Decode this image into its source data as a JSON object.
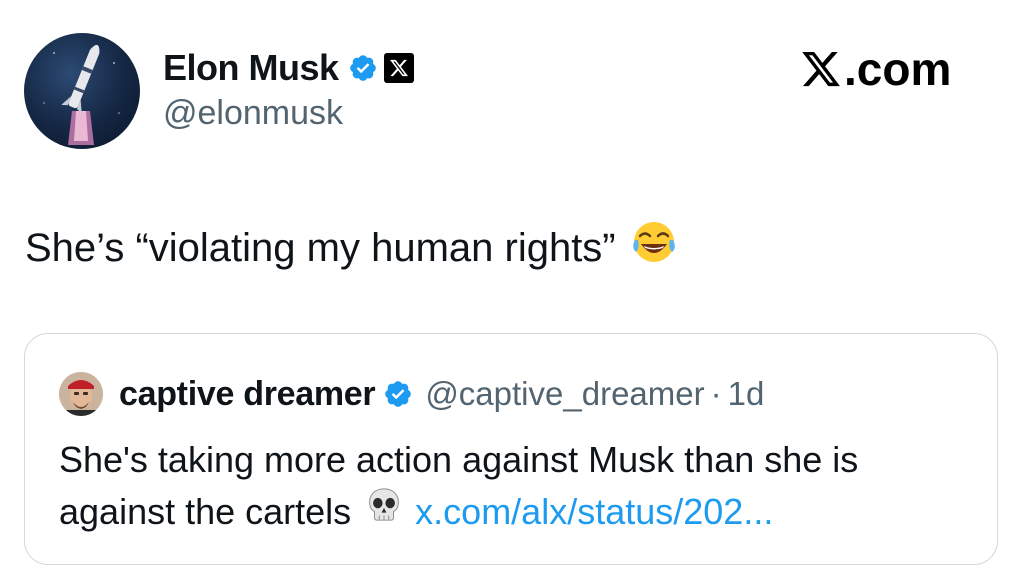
{
  "author": {
    "display_name": "Elon Musk",
    "handle": "@elonmusk",
    "verified_badge_color": "#1d9bf0",
    "avatar_icon": "rocket-launch-avatar",
    "affiliate_icon": "x-logo-icon"
  },
  "site": {
    "label": ".com",
    "logo_icon": "x-logo-icon"
  },
  "tweet": {
    "text": "She’s “violating my human rights”",
    "emoji": "face-with-tears-of-joy"
  },
  "quoted_tweet": {
    "display_name": "captive dreamer",
    "handle": "@captive_dreamer",
    "separator": "·",
    "time": "1d",
    "line1": "She's taking more action against Musk than she is",
    "line2": "against the cartels",
    "emoji": "skull",
    "link": "x.com/alx/status/202...",
    "link_color": "#1d9bf0",
    "verified_badge_color": "#1d9bf0"
  },
  "colors": {
    "text": "#0f1419",
    "secondary": "#536471",
    "border": "#cfd9de"
  }
}
